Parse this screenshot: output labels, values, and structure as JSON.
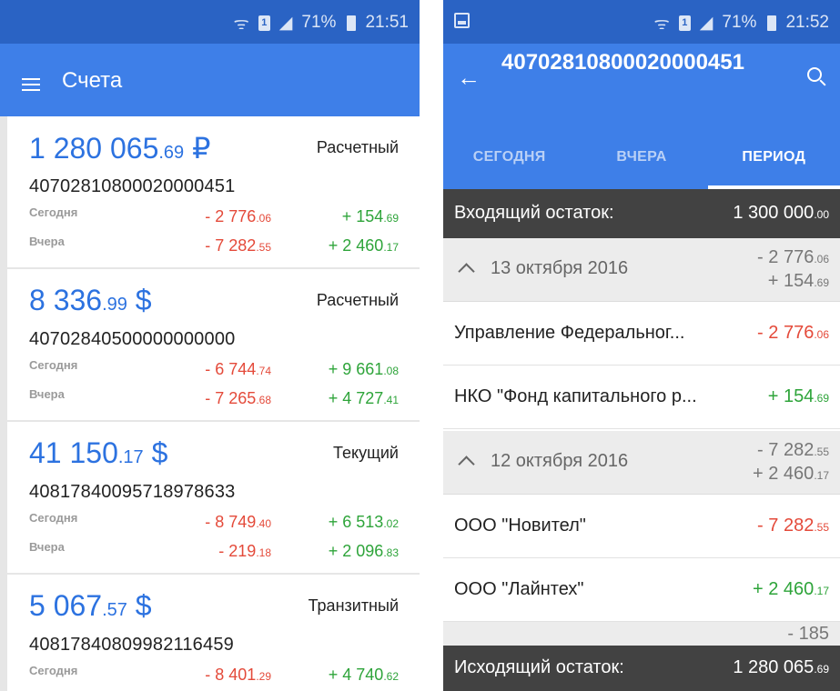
{
  "left": {
    "status": {
      "battery": "71%",
      "time": "21:51",
      "sim": "1"
    },
    "title": "Счета",
    "accounts": [
      {
        "balance_int": "1 280 065",
        "balance_frac": ".69",
        "currency": " ₽",
        "type": "Расчетный",
        "number": "40702810800020000451",
        "today_label": "Сегодня",
        "today_minus_int": "- 2 776",
        "today_minus_frac": ".06",
        "today_plus_int": "+ 154",
        "today_plus_frac": ".69",
        "yesterday_label": "Вчера",
        "yesterday_minus_int": "- 7 282",
        "yesterday_minus_frac": ".55",
        "yesterday_plus_int": "+ 2 460",
        "yesterday_plus_frac": ".17"
      },
      {
        "balance_int": "8 336",
        "balance_frac": ".99",
        "currency": " $",
        "type": "Расчетный",
        "number": "40702840500000000000",
        "today_label": "Сегодня",
        "today_minus_int": "- 6 744",
        "today_minus_frac": ".74",
        "today_plus_int": "+ 9 661",
        "today_plus_frac": ".08",
        "yesterday_label": "Вчера",
        "yesterday_minus_int": "- 7 265",
        "yesterday_minus_frac": ".68",
        "yesterday_plus_int": "+ 4 727",
        "yesterday_plus_frac": ".41"
      },
      {
        "balance_int": "41 150",
        "balance_frac": ".17",
        "currency": " $",
        "type": "Текущий",
        "number": "40817840095718978633",
        "today_label": "Сегодня",
        "today_minus_int": "- 8 749",
        "today_minus_frac": ".40",
        "today_plus_int": "+ 6 513",
        "today_plus_frac": ".02",
        "yesterday_label": "Вчера",
        "yesterday_minus_int": "- 219",
        "yesterday_minus_frac": ".18",
        "yesterday_plus_int": "+ 2 096",
        "yesterday_plus_frac": ".83"
      },
      {
        "balance_int": "5 067",
        "balance_frac": ".57",
        "currency": " $",
        "type": "Транзитный",
        "number": "40817840809982116459",
        "today_label": "Сегодня",
        "today_minus_int": "- 8 401",
        "today_minus_frac": ".29",
        "today_plus_int": "+ 4 740",
        "today_plus_frac": ".62"
      }
    ]
  },
  "right": {
    "status": {
      "battery": "71%",
      "time": "21:52",
      "sim": "1"
    },
    "title": "40702810800020000451",
    "tabs": [
      "СЕГОДНЯ",
      "ВЧЕРА",
      "ПЕРИОД"
    ],
    "opening_label": "Входящий остаток:",
    "opening_int": "1 300 000",
    "opening_frac": ".00",
    "days": [
      {
        "date": "13 октября 2016",
        "minus_int": "- 2 776",
        "minus_frac": ".06",
        "plus_int": "+ 154",
        "plus_frac": ".69",
        "ops": [
          {
            "name": "Управление Федеральног...",
            "amount_int": "- 2 776",
            "amount_frac": ".06"
          },
          {
            "name": "НКО \"Фонд капитального р...",
            "amount_int": "+ 154",
            "amount_frac": ".69"
          }
        ]
      },
      {
        "date": "12 октября 2016",
        "minus_int": "- 7 282",
        "minus_frac": ".55",
        "plus_int": "+ 2 460",
        "plus_frac": ".17",
        "ops": [
          {
            "name": "ООО \"Новител\"",
            "amount_int": "- 7 282",
            "amount_frac": ".55"
          },
          {
            "name": "ООО \"Лайнтех\"",
            "amount_int": "+ 2 460",
            "amount_frac": ".17"
          }
        ]
      }
    ],
    "next_peek": "- 185",
    "closing_label": "Исходящий остаток:",
    "closing_int": "1 280 065",
    "closing_frac": ".69"
  },
  "colors": {
    "status_bar": "#2a63c4",
    "app_bar": "#3e7fe8",
    "balance_blue": "#2c72e0",
    "debit_red": "#e44a3a",
    "credit_green": "#2ea43a",
    "balance_bar": "#424242"
  }
}
